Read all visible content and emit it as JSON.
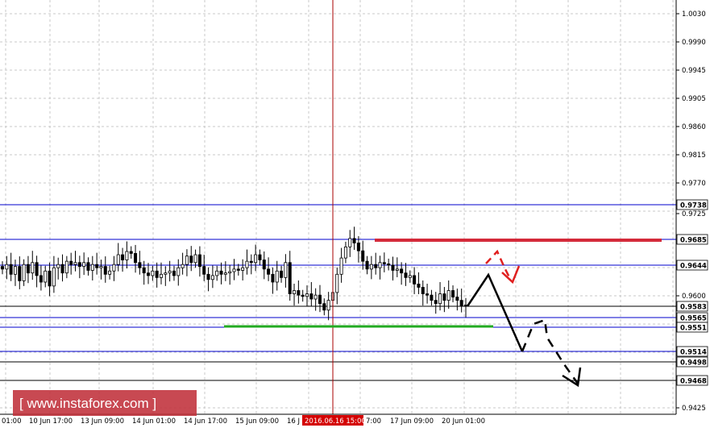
{
  "chart_data": {
    "type": "candlestick",
    "y_axis": {
      "ylim": [
        0.9425,
        1.003
      ],
      "ticks": [
        "1.0030",
        "0.9990",
        "0.9945",
        "0.9905",
        "0.9860",
        "0.9815",
        "0.9770",
        "0.9725",
        "0.9600",
        "0.9425"
      ]
    },
    "x_axis": {
      "ticks": [
        "01:00",
        "10 Jun 17:00",
        "13 Jun 09:00",
        "14 Jun 01:00",
        "14 Jun 17:00",
        "15 Jun 09:00",
        "16 J",
        "7:00",
        "17 Jun 09:00",
        "20 Jun 01:00"
      ],
      "crosshair_label": "2016.06.16 15:00"
    },
    "horizontal_levels": [
      {
        "label": "0.9738",
        "value": 0.9738,
        "color": "#0000cc"
      },
      {
        "label": "0.9685",
        "value": 0.9685,
        "color": "#0000cc"
      },
      {
        "label": "0.9644",
        "value": 0.9644,
        "color": "#0000cc"
      },
      {
        "label": "0.9583",
        "value": 0.9583,
        "color": "#000000"
      },
      {
        "label": "0.9565",
        "value": 0.9565,
        "color": "#0000cc"
      },
      {
        "label": "0.9551",
        "value": 0.9551,
        "color": "#0000cc"
      },
      {
        "label": "0.9514",
        "value": 0.9514,
        "color": "#0000cc"
      },
      {
        "label": "0.9498",
        "value": 0.9498,
        "color": "#000000"
      },
      {
        "label": "0.9468",
        "value": 0.9468,
        "color": "#000000"
      }
    ],
    "segments": [
      {
        "name": "resistance-line",
        "color": "#d42a3a",
        "y": 0.9685
      },
      {
        "name": "support-line",
        "color": "#22aa22",
        "y": 0.9552
      }
    ],
    "closes": [
      0.9638,
      0.9645,
      0.963,
      0.9642,
      0.962,
      0.9645,
      0.9632,
      0.9648,
      0.9628,
      0.9618,
      0.9635,
      0.9612,
      0.964,
      0.9645,
      0.9632,
      0.965,
      0.9645,
      0.9648,
      0.9642,
      0.9648,
      0.9636,
      0.9645,
      0.964,
      0.9642,
      0.963,
      0.9635,
      0.9645,
      0.966,
      0.9652,
      0.9665,
      0.9662,
      0.9648,
      0.964,
      0.9632,
      0.9628,
      0.9635,
      0.9625,
      0.963,
      0.9632,
      0.9635,
      0.9628,
      0.964,
      0.9645,
      0.9658,
      0.9648,
      0.966,
      0.9642,
      0.963,
      0.9622,
      0.9628,
      0.9635,
      0.963,
      0.9632,
      0.9634,
      0.9638,
      0.9636,
      0.964,
      0.965,
      0.9648,
      0.966,
      0.9652,
      0.9638,
      0.963,
      0.9618,
      0.9635,
      0.9625,
      0.9648,
      0.96,
      0.9605,
      0.9598,
      0.9596,
      0.96,
      0.9592,
      0.9598,
      0.9585,
      0.9575,
      0.959,
      0.9602,
      0.963,
      0.9655,
      0.9672,
      0.9685,
      0.9678,
      0.9666,
      0.965,
      0.9638,
      0.9645,
      0.964,
      0.9648,
      0.9646,
      0.9644,
      0.9636,
      0.9638,
      0.9632,
      0.9625,
      0.9628,
      0.9615,
      0.961,
      0.96,
      0.9598,
      0.959,
      0.9585,
      0.96,
      0.959,
      0.9605,
      0.9595,
      0.959,
      0.9582,
      0.9583
    ],
    "forecast_paths": [
      {
        "name": "red-forecast",
        "color": "#e02020",
        "style": "dashed"
      },
      {
        "name": "black-forecast",
        "color": "#000000",
        "style": "solid-then-dashed"
      }
    ]
  },
  "watermark": {
    "text": "[ www.instaforex.com ]"
  }
}
